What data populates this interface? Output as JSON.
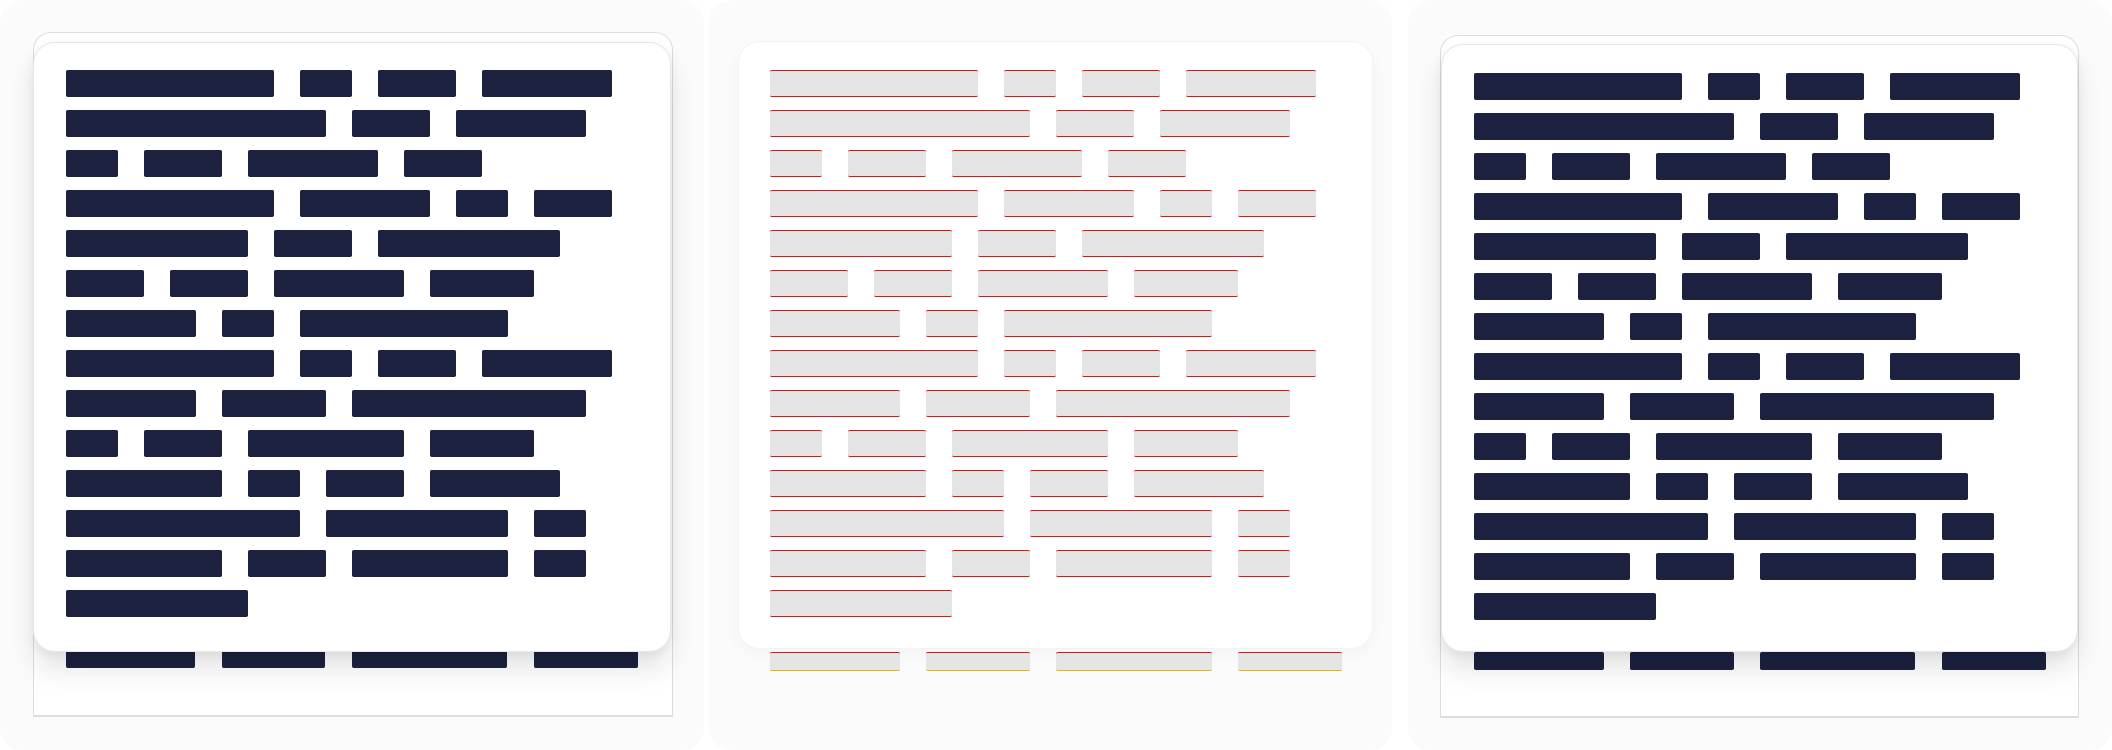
{
  "colors": {
    "block_solid": "#1c2140",
    "block_ghost": "#e5e5e5",
    "block_line": "#f10d0d",
    "indicator_red": "#ff1b1b",
    "indicator_blue": "#3b5bdb",
    "panel_bg": "#fbfbfb"
  },
  "panels": [
    {
      "id": "left"
    },
    {
      "id": "middle"
    },
    {
      "id": "right"
    }
  ]
}
